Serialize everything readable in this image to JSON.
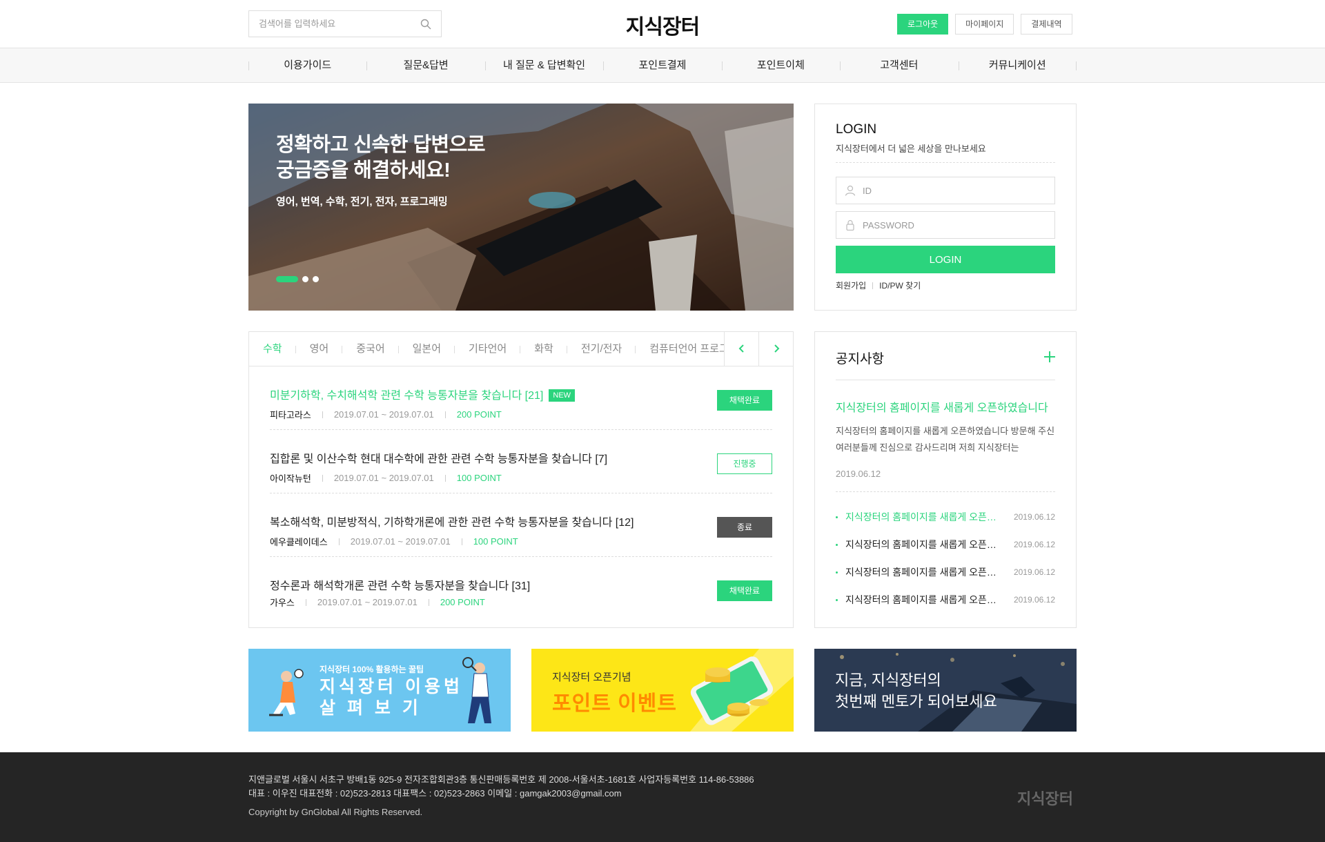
{
  "header": {
    "search_placeholder": "검색어를 입력하세요",
    "logo": "지식장터",
    "buttons": {
      "logout": "로그아웃",
      "mypage": "마이페이지",
      "payments": "결제내역"
    }
  },
  "nav": [
    "이용가이드",
    "질문&답변",
    "내 질문 & 답변확인",
    "포인트결제",
    "포인트이체",
    "고객센터",
    "커뮤니케이션"
  ],
  "banner": {
    "title": "정확하고 신속한 답변으로\n궁금증을 해결하세요!",
    "subtitle": "영어, 번역, 수학, 전기, 전자, 프로그래밍",
    "slide_count": 3,
    "active_slide": 1
  },
  "login": {
    "title": "LOGIN",
    "desc": "지식장터에서 더 넓은 세상을 만나보세요",
    "id_placeholder": "ID",
    "pw_placeholder": "PASSWORD",
    "button": "LOGIN",
    "join": "회원가입",
    "find": "ID/PW 찾기"
  },
  "board": {
    "tabs": [
      "수학",
      "영어",
      "중국어",
      "일본어",
      "기타언어",
      "화학",
      "전기/전자",
      "컴퓨터언어 프로그래밍"
    ],
    "active_tab": 0,
    "items": [
      {
        "title": "미분기하학, 수치해석학 관련 수학 능통자분을 찾습니다 [21]",
        "is_new": true,
        "new_label": "NEW",
        "author": "피타고라스",
        "date": "2019.07.01 ~ 2019.07.01",
        "point": "200 POINT",
        "status": "채택완료",
        "status_type": "done"
      },
      {
        "title": "집합론 및 이산수학 현대 대수학에 관한 관련 수학 능통자분을 찾습니다 [7]",
        "is_new": false,
        "author": "아이작뉴턴",
        "date": "2019.07.01 ~ 2019.07.01",
        "point": "100 POINT",
        "status": "진행중",
        "status_type": "prog"
      },
      {
        "title": "복소해석학, 미분방적식, 기하학개론에 관한 관련 수학 능통자분을 찾습니다 [12]",
        "is_new": false,
        "author": "에우클레이데스",
        "date": "2019.07.01 ~ 2019.07.01",
        "point": "100 POINT",
        "status": "종료",
        "status_type": "end"
      },
      {
        "title": "정수론과 해석학개론 관련 수학 능통자분을 찾습니다 [31]",
        "is_new": false,
        "author": "가우스",
        "date": "2019.07.01 ~ 2019.07.01",
        "point": "200 POINT",
        "status": "채택완료",
        "status_type": "done"
      }
    ]
  },
  "notice": {
    "title": "공지사항",
    "featured": {
      "title": "지식장터의 홈페이지를 새롭게 오픈하였습니다",
      "body": "지식장터의 홈페이지를 새롭게 오픈하였습니다 방문해 주신 여러분들께 진심으로 감사드리며 저희 지식장터는",
      "date": "2019.06.12"
    },
    "items": [
      {
        "title": "지식장터의 홈페이지를 새롭게 오픈하였습니다",
        "date": "2019.06.12"
      },
      {
        "title": "지식장터의 홈페이지를 새롭게 오픈하였습니다",
        "date": "2019.06.12"
      },
      {
        "title": "지식장터의 홈페이지를 새롭게 오픈하였습니다",
        "date": "2019.06.12"
      },
      {
        "title": "지식장터의 홈페이지를 새롭게 오픈하였습니다",
        "date": "2019.06.12"
      }
    ]
  },
  "promos": {
    "guide": {
      "small": "지식장터 100% 활용하는 꿀팁",
      "big": "지식장터 이용법\n살 펴 보 기"
    },
    "event": {
      "small": "지식장터 오픈기념",
      "big": "포인트 이벤트"
    },
    "mentor": {
      "big": "지금, 지식장터의\n첫번째 멘토가 되어보세요"
    }
  },
  "footer": {
    "line1": "지앤글로벌 서울시 서초구 방배1동 925-9 전자조합회관3층 통신판매등록번호 제 2008-서울서초-1681호 사업자등록번호 114-86-53886",
    "line2": "대표 : 이우진 대표전화 : 02)523-2813 대표팩스 : 02)523-2863 이메일 : gamgak2003@gmail.com",
    "copyright": "Copyright by GnGlobal All Rights Reserved.",
    "logo": "지식장터"
  },
  "colors": {
    "accent": "#2bd47d",
    "footer_bg": "#252525",
    "ended": "#555555"
  }
}
